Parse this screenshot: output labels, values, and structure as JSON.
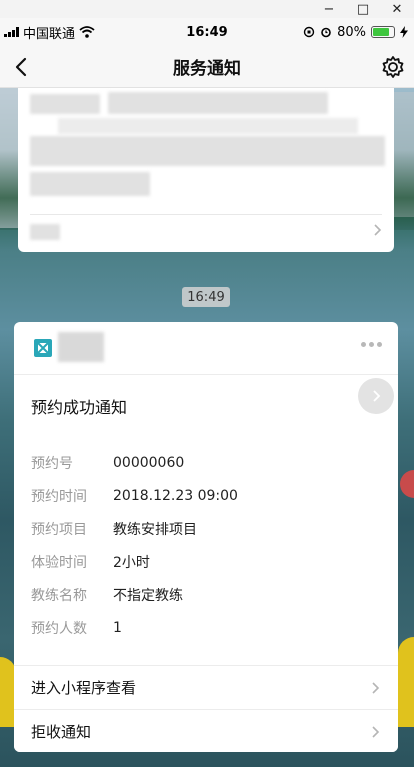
{
  "window_controls": {
    "minimize": "−",
    "maximize": "□",
    "close": "✕"
  },
  "status_bar": {
    "carrier": "中国联通",
    "time": "16:49",
    "battery": "80%",
    "battery_level": 0.8
  },
  "nav": {
    "title": "服务通知"
  },
  "timestamp": "16:49",
  "card": {
    "title": "预约成功通知",
    "fields": [
      {
        "label": "预约号",
        "value": "00000060"
      },
      {
        "label": "预约时间",
        "value": "2018.12.23 09:00"
      },
      {
        "label": "预约项目",
        "value": "教练安排项目"
      },
      {
        "label": "体验时间",
        "value": "2小时"
      },
      {
        "label": "教练名称",
        "value": "不指定教练"
      },
      {
        "label": "预约人数",
        "value": "1"
      }
    ],
    "actions": {
      "open_miniprogram": "进入小程序查看",
      "reject": "拒收通知"
    }
  },
  "colors": {
    "accent_green": "#3ec63e",
    "logo_teal": "#2aa7b8",
    "label_gray": "#999999"
  }
}
